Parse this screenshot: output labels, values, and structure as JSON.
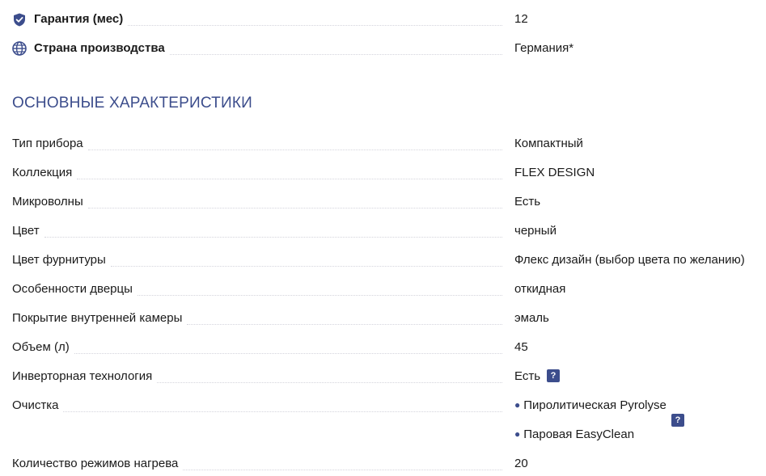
{
  "top_rows": [
    {
      "label": "Гарантия (мес)",
      "value": "12",
      "icon": "shield-check-icon"
    },
    {
      "label": "Страна производства",
      "value": "Германия*",
      "icon": "globe-icon"
    }
  ],
  "section": {
    "title": "ОСНОВНЫЕ ХАРАКТЕРИСТИКИ"
  },
  "specs": [
    {
      "label": "Тип прибора",
      "value": "Компактный"
    },
    {
      "label": "Коллекция",
      "value": "FLEX DESIGN"
    },
    {
      "label": "Микроволны",
      "value": "Есть"
    },
    {
      "label": "Цвет",
      "value": "черный"
    },
    {
      "label": "Цвет фурнитуры",
      "value": "Флекс дизайн (выбор цвета по желанию)"
    },
    {
      "label": "Особенности дверцы",
      "value": "откидная"
    },
    {
      "label": "Покрытие внутренней камеры",
      "value": "эмаль"
    },
    {
      "label": "Объем (л)",
      "value": "45"
    },
    {
      "label": "Инверторная технология",
      "value": "Есть",
      "help": "?"
    },
    {
      "label": "Очистка",
      "values": [
        "Пиролитическая Pyrolyse",
        "Паровая EasyClean"
      ],
      "help": "?",
      "bullet": "●"
    },
    {
      "label": "Количество режимов нагрева",
      "value": "20"
    }
  ],
  "colors": {
    "accent": "#3c4d8c",
    "text": "#1a1a1a",
    "dots": "#d4d4dc"
  }
}
